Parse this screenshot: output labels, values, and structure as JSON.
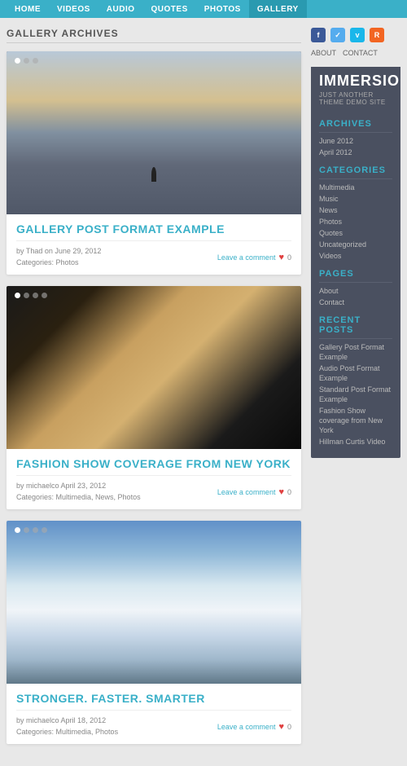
{
  "nav": {
    "items": [
      {
        "label": "HOME",
        "active": false
      },
      {
        "label": "VIDEOS",
        "active": false
      },
      {
        "label": "AUDIO",
        "active": false
      },
      {
        "label": "QUOTES",
        "active": false
      },
      {
        "label": "PHOTOS",
        "active": false
      },
      {
        "label": "GALLERY",
        "active": true
      }
    ]
  },
  "page_title": "GALLERY ARCHIVES",
  "posts": [
    {
      "title": "GALLERY POST FORMAT EXAMPLE",
      "author": "Thad",
      "date": "June 29, 2012",
      "categories": "Photos",
      "comment_text": "Leave a comment",
      "image_type": "mountain",
      "dots": 3
    },
    {
      "title": "FASHION SHOW COVERAGE FROM NEW YORK",
      "author": "michaelco",
      "date": "April 23, 2012",
      "categories": "Multimedia, News, Photos",
      "comment_text": "Leave a comment",
      "image_type": "woman",
      "dots": 4
    },
    {
      "title": "STRONGER. FASTER. SMARTER",
      "author": "michaelco",
      "date": "April 18, 2012",
      "categories": "Multimedia, Photos",
      "comment_text": "Leave a comment",
      "image_type": "ski",
      "dots": 4
    }
  ],
  "sidebar": {
    "social": [
      {
        "name": "facebook",
        "symbol": "f"
      },
      {
        "name": "twitter",
        "symbol": "t"
      },
      {
        "name": "vimeo",
        "symbol": "v"
      },
      {
        "name": "rss",
        "symbol": "r"
      }
    ],
    "links": [
      {
        "label": "ABOUT"
      },
      {
        "label": "CONTACT"
      }
    ],
    "brand_title": "IMMERSION",
    "brand_subtitle": "JUST ANOTHER THEME DEMO SITE",
    "archives_title": "ARCHIVES",
    "archives": [
      {
        "label": "June 2012"
      },
      {
        "label": "April 2012"
      }
    ],
    "categories_title": "CATEGORIES",
    "categories": [
      {
        "label": "Multimedia"
      },
      {
        "label": "Music"
      },
      {
        "label": "News"
      },
      {
        "label": "Photos"
      },
      {
        "label": "Quotes"
      },
      {
        "label": "Uncategorized"
      },
      {
        "label": "Videos"
      }
    ],
    "pages_title": "PAGES",
    "pages": [
      {
        "label": "About"
      },
      {
        "label": "Contact"
      }
    ],
    "recent_posts_title": "RECENT POSTS",
    "recent_posts": [
      {
        "label": "Gallery Post Format Example"
      },
      {
        "label": "Audio Post Format Example"
      },
      {
        "label": "Standard Post Format Example"
      },
      {
        "label": "Fashion Show coverage from New York"
      },
      {
        "label": "Hillman Curtis Video"
      }
    ]
  }
}
